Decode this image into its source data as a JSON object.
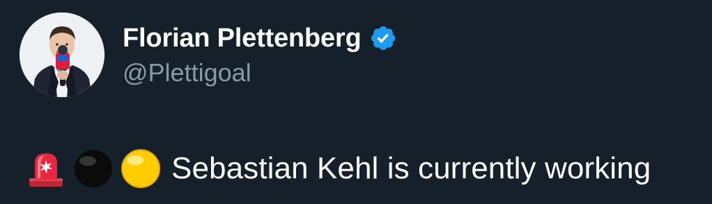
{
  "author": {
    "display_name": "Florian Plettenberg",
    "handle": "@Plettigoal",
    "verified": true,
    "verified_color": "#1d9bf0"
  },
  "tweet": {
    "emojis": [
      "rotating-light-icon",
      "black-circle-icon",
      "yellow-circle-icon"
    ],
    "text": "Sebastian Kehl is currently working"
  },
  "theme": {
    "background": "#15202b",
    "primary_text": "#ffffff",
    "secondary_text": "#8b98a5"
  }
}
